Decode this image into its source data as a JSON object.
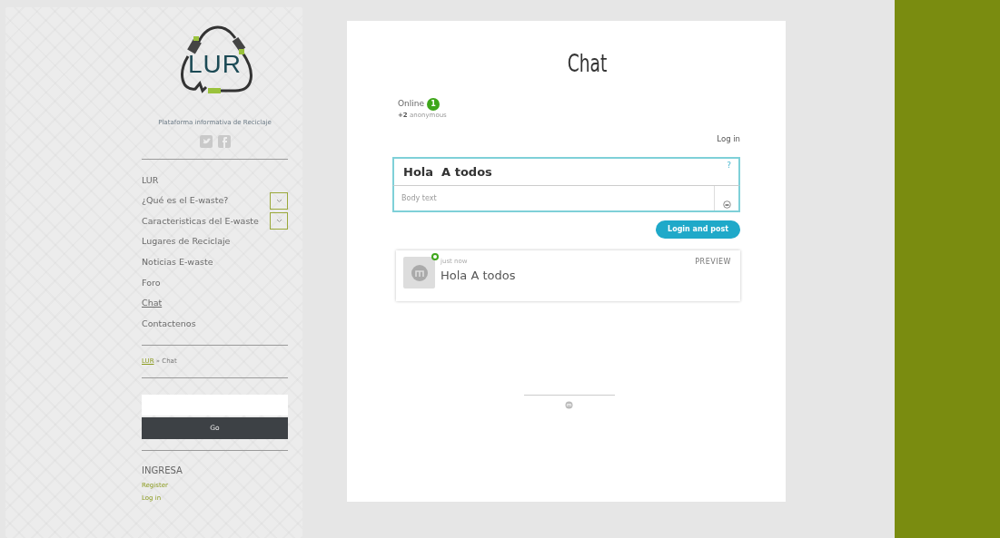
{
  "site": {
    "logo_text": "LUR",
    "tagline": "Plataforma informativa de Reciclaje"
  },
  "nav": [
    {
      "label": "LUR",
      "selected": false,
      "expandable": false
    },
    {
      "label": "¿Qué es el E-waste?",
      "selected": false,
      "expandable": true
    },
    {
      "label": "Caracteristicas del E-waste",
      "selected": false,
      "expandable": true
    },
    {
      "label": "Lugares de Reciclaje",
      "selected": false,
      "expandable": false
    },
    {
      "label": "Noticias E-waste",
      "selected": false,
      "expandable": false
    },
    {
      "label": "Foro",
      "selected": false,
      "expandable": false
    },
    {
      "label": "Chat",
      "selected": true,
      "expandable": false
    },
    {
      "label": "Contactenos",
      "selected": false,
      "expandable": false
    }
  ],
  "breadcrumb": {
    "link": "LUR",
    "separator": "»",
    "current": "Chat"
  },
  "search": {
    "button": "Go"
  },
  "login_section": {
    "title": "INGRESA",
    "links": [
      "Register",
      "Log in"
    ]
  },
  "chat": {
    "title": "Chat",
    "online_label": "Online",
    "online_count": "1",
    "anonymous_count": "+2",
    "anonymous_label": "anonymous",
    "login_link": "Log in",
    "composer": {
      "title_value": "Hola  A todos",
      "help": "?",
      "body_placeholder": "Body text",
      "submit": "Login and post"
    },
    "preview": {
      "time": "just now",
      "text": "Hola A todos",
      "label": "PREVIEW",
      "online": true
    }
  }
}
